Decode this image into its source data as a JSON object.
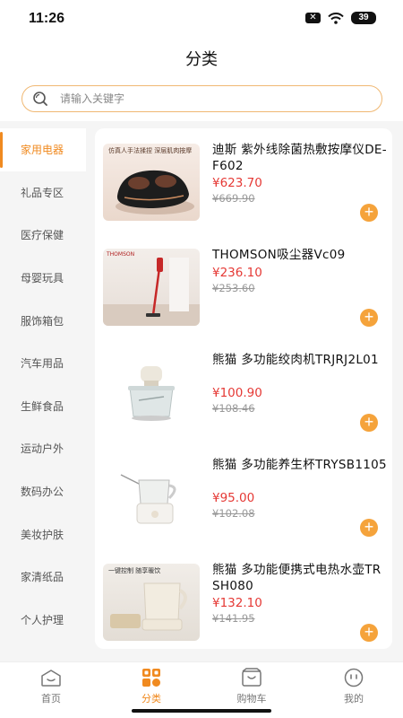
{
  "status_bar": {
    "time": "11:26",
    "battery": "39"
  },
  "page_title": "分类",
  "search": {
    "placeholder": "请输入关键字"
  },
  "sidebar": {
    "items": [
      {
        "label": "家用电器",
        "active": true
      },
      {
        "label": "礼品专区"
      },
      {
        "label": "医疗保健"
      },
      {
        "label": "母婴玩具"
      },
      {
        "label": "服饰箱包"
      },
      {
        "label": "汽车用品"
      },
      {
        "label": "生鲜食品"
      },
      {
        "label": "运动户外"
      },
      {
        "label": "数码办公"
      },
      {
        "label": "美妆护肤"
      },
      {
        "label": "家清纸品"
      },
      {
        "label": "个人护理"
      }
    ]
  },
  "products": [
    {
      "name": "迪斯 紫外线除菌热敷按摩仪DE-F602",
      "price": "¥623.70",
      "original_price": "¥669.90",
      "image_caption": "仿真人手法揉捏 深层肌肉按摩",
      "image_icon": "foot-massager"
    },
    {
      "name": "THOMSON吸尘器Vc09",
      "price": "¥236.10",
      "original_price": "¥253.60",
      "image_caption": "THOMSON",
      "image_icon": "vacuum-cleaner"
    },
    {
      "name": "熊猫 多功能绞肉机TRJRJ2L01",
      "price": "¥100.90",
      "original_price": "¥108.46",
      "image_icon": "meat-grinder"
    },
    {
      "name": "熊猫 多功能养生杯TRYSB1105",
      "price": "¥95.00",
      "original_price": "¥102.08",
      "image_icon": "health-kettle"
    },
    {
      "name": "熊猫 多功能便携式电热水壶TRSH080",
      "price": "¥132.10",
      "original_price": "¥141.95",
      "image_caption": "一键控制 随享暖饮",
      "image_icon": "electric-kettle"
    }
  ],
  "add_symbol": "+",
  "tabbar": {
    "items": [
      {
        "label": "首页",
        "icon": "home-icon"
      },
      {
        "label": "分类",
        "icon": "category-icon",
        "active": true
      },
      {
        "label": "购物车",
        "icon": "cart-icon"
      },
      {
        "label": "我的",
        "icon": "profile-icon"
      }
    ]
  },
  "colors": {
    "accent": "#f08a20",
    "price": "#e53935",
    "add_button": "#f5a33b",
    "search_border": "#f0b873"
  }
}
